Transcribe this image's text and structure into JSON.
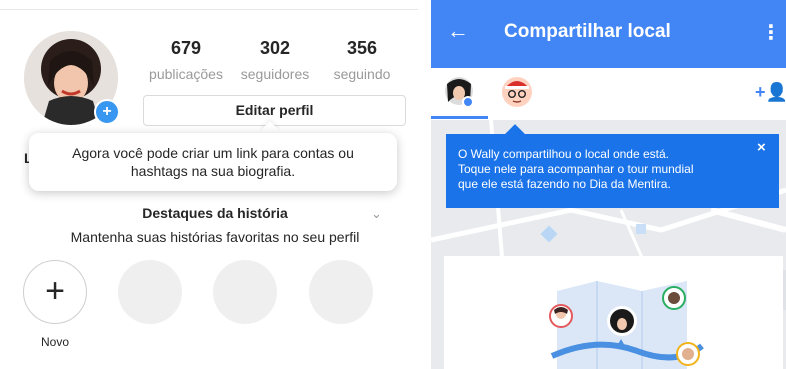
{
  "instagram": {
    "stats": [
      {
        "value": "679",
        "label": "publicações"
      },
      {
        "value": "302",
        "label": "seguidores"
      },
      {
        "value": "356",
        "label": "seguindo"
      }
    ],
    "edit_button": "Editar perfil",
    "tooltip_line1": "Agora você pode criar um link para contas ou",
    "tooltip_line2": "hashtags na sua biografia.",
    "left_edge_char": "L",
    "highlights_title": "Destaques da história",
    "highlights_subtitle": "Mantenha suas histórias favoritas no seu perfil",
    "new_label": "Novo",
    "plus_symbol": "+",
    "badge_symbol": "+",
    "chevron": "⌄"
  },
  "maps": {
    "back_icon": "←",
    "title": "Compartilhar local",
    "menu_icon": "⋮",
    "add_person_icon": "+👤",
    "info_line1": "O Wally compartilhou o local onde está.",
    "info_line2": "Toque nele para acompanhar o tour mundial",
    "info_line3": "que ele está fazendo no Dia da Mentira.",
    "close_icon": "×",
    "accent_color": "#4285f4",
    "banner_color": "#1a73e8"
  },
  "icons": {
    "avatar": "user-avatar-icon",
    "wally": "wally-avatar-icon",
    "map_illustration": "map-illustration-icon"
  }
}
